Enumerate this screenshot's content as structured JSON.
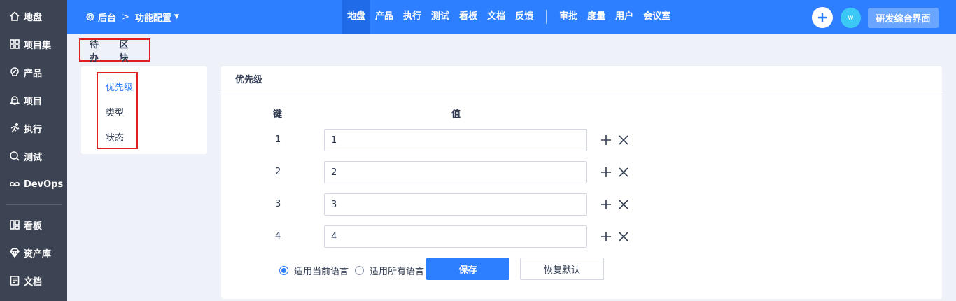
{
  "sidebar": {
    "items": [
      {
        "label": "地盘",
        "icon": "home-icon"
      },
      {
        "label": "项目集",
        "icon": "grid-icon"
      },
      {
        "label": "产品",
        "icon": "bulb-icon"
      },
      {
        "label": "项目",
        "icon": "bell-icon"
      },
      {
        "label": "执行",
        "icon": "run-icon"
      },
      {
        "label": "测试",
        "icon": "search-icon"
      },
      {
        "label": "DevOps",
        "icon": "infinity-icon"
      },
      {
        "label": "看板",
        "icon": "kanban-icon"
      },
      {
        "label": "资产库",
        "icon": "diamond-icon"
      },
      {
        "label": "文档",
        "icon": "document-icon"
      }
    ]
  },
  "header": {
    "breadcrumb_root": "后台",
    "breadcrumb_sep": ">",
    "breadcrumb_current": "功能配置",
    "nav": [
      "地盘",
      "产品",
      "执行",
      "测试",
      "看板",
      "文档",
      "反馈"
    ],
    "nav2": [
      "审批",
      "度量",
      "用户",
      "会议室"
    ],
    "active": "地盘",
    "avatar_text": "w",
    "workspace_label": "研发综合界面"
  },
  "subtabs": [
    "待办",
    "区块"
  ],
  "left_menu": [
    "优先级",
    "类型",
    "状态"
  ],
  "panel": {
    "title": "优先级",
    "key_header": "键",
    "value_header": "值",
    "rows": [
      {
        "key": "1",
        "value": "1"
      },
      {
        "key": "2",
        "value": "2"
      },
      {
        "key": "3",
        "value": "3"
      },
      {
        "key": "4",
        "value": "4"
      }
    ],
    "radio_current": "适用当前语言",
    "radio_all": "适用所有语言",
    "save_label": "保存",
    "reset_label": "恢复默认"
  },
  "colors": {
    "accent": "#2e7fff",
    "sidebar": "#3c4353",
    "highlight_box": "#e02020"
  }
}
